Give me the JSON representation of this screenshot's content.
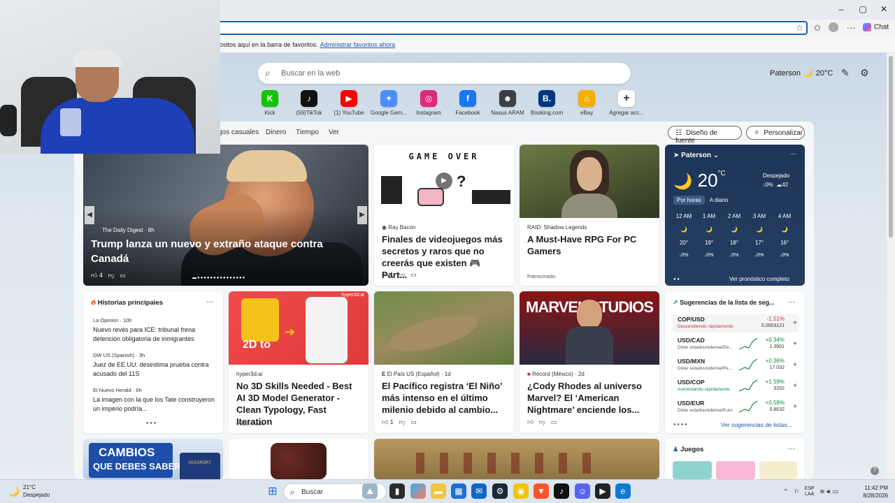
{
  "window": {
    "min": "–",
    "max": "▢",
    "close": "✕"
  },
  "toolbar": {
    "chat_label": "Chat"
  },
  "favorites_bar": {
    "text": "ositos aquí en la barra de favoritos.",
    "link": "Administrar favoritos ahora"
  },
  "search": {
    "placeholder": "Buscar en la web"
  },
  "weather_top": {
    "city": "Paterson",
    "temp": "20°C"
  },
  "quick_links": [
    {
      "label": "Kick",
      "glyph": "K",
      "color": "#12c400"
    },
    {
      "label": "(59)TikTok",
      "glyph": "♪",
      "color": "#111111"
    },
    {
      "label": "(1) YouTube",
      "glyph": "▶",
      "color": "#ff0000"
    },
    {
      "label": "Google Gem...",
      "glyph": "✦",
      "color": "#4b8df8"
    },
    {
      "label": "Instagram",
      "glyph": "◎",
      "color": "#dd2a7b"
    },
    {
      "label": "Facebook",
      "glyph": "f",
      "color": "#1877f2"
    },
    {
      "label": "Nasus ARAM",
      "glyph": "☻",
      "color": "#3b3f46"
    },
    {
      "label": "Booking.com",
      "glyph": "B.",
      "color": "#003580"
    },
    {
      "label": "eBay",
      "glyph": "⌂",
      "color": "#f5af02"
    },
    {
      "label": "Agregar acc...",
      "glyph": "+",
      "color": "#ffffff"
    }
  ],
  "nav": {
    "items": [
      "gos casuales",
      "Dinero",
      "Tiempo",
      "Ver"
    ]
  },
  "buttons": {
    "font": "Diseño de fuente",
    "personalize": "Personalizar"
  },
  "hero": {
    "source": "The Daily Digest · 8h",
    "title": "Trump lanza un nuevo y extraño ataque contra Canadá",
    "likes": "4"
  },
  "card_game": {
    "banner": "GAME OVER",
    "source": "Ray Bacon",
    "title": "Finales de videojuegos más secretos y raros que no creerás que existen 🎮 Part...",
    "likes": "1"
  },
  "card_raid": {
    "source": "RAID: Shadow Legends",
    "title": "A Must-Have RPG For PC Gamers",
    "sponsored": "Patrocinado"
  },
  "weather": {
    "city": "Paterson",
    "temp": "20",
    "unit": "°C",
    "condition": "Despejado",
    "precip": "0%",
    "humidity": "42",
    "tab_hourly": "Por horas",
    "tab_daily": "A diario",
    "hours": [
      {
        "time": "12 AM",
        "temp": "20°",
        "rain": "0%"
      },
      {
        "time": "1 AM",
        "temp": "19°",
        "rain": "0%"
      },
      {
        "time": "2 AM",
        "temp": "18°",
        "rain": "0%"
      },
      {
        "time": "3 AM",
        "temp": "17°",
        "rain": "0%"
      },
      {
        "time": "4 AM",
        "temp": "16°",
        "rain": "0%"
      }
    ],
    "more": "Ver pronóstico completo"
  },
  "stories": {
    "header": "Historias principales",
    "items": [
      {
        "source": "La Opinion · 10h",
        "title": "Nuevo revés para ICE: tribunal frena detención obligatoria de inmigrantes"
      },
      {
        "source": "DW US (Spanish) · 3h",
        "title": "Juez de EE.UU. desestima prueba contra acusado del 11S"
      },
      {
        "source": "El Nuevo Herald · 6h",
        "title": "La imagen con la que los Tate construyeron un imperio podría..."
      }
    ]
  },
  "card_3d": {
    "badge": "hyper3d.ai",
    "img_text": "2D to",
    "source": "hyper3d.ai",
    "title": "No 3D Skills Needed - Best AI 3D Model Generator - Clean Typology, Fast Iteration",
    "sponsored": "Patrocinado"
  },
  "card_nino": {
    "source": "El País US (Español) · 1d",
    "title": "El Pacífico registra ‘El Niño’ más intenso en el último milenio debido al cambio...",
    "likes": "1"
  },
  "card_cody": {
    "img_text": "MARVEL STUDIOS",
    "source": "Récord (México) · 2d",
    "title": "¿Cody Rhodes al universo Marvel? El ‘American Nightmare’ enciende los..."
  },
  "fx": {
    "header": "Sugerencias de la lista de seg...",
    "rows": [
      {
        "pair": "COP/USD",
        "desc": "Descendiendo rápidamente",
        "change": "-1.51%",
        "value": "0.0003121",
        "down": true
      },
      {
        "pair": "USD/CAD",
        "desc": "Dólar estadounidense/Dó...",
        "change": "+0.34%",
        "value": "1.3901",
        "down": false
      },
      {
        "pair": "USD/MXN",
        "desc": "Dólar estadounidense/Pe...",
        "change": "+0.36%",
        "value": "17.032",
        "down": false
      },
      {
        "pair": "USD/COP",
        "desc": "Aumentando rápidamente",
        "change": "+1.59%",
        "value": "3202",
        "down": false
      },
      {
        "pair": "USD/EUR",
        "desc": "Dólar estadounidense/Euro",
        "change": "+0.59%",
        "value": "0.8632",
        "down": false
      }
    ],
    "more": "Ver sugerencias de listas..."
  },
  "bottom": {
    "cambios_line1": "CAMBIOS",
    "cambios_line2": "QUE DEBES SABER",
    "passport": "PASSPORT",
    "games": "Juegos"
  },
  "taskbar": {
    "weather_temp": "21°C",
    "weather_cond": "Despejado",
    "search": "Buscar",
    "lang1": "ESP",
    "lang2": "LAA",
    "time": "11:42 PM",
    "date": "8/28/2026"
  },
  "colors": {
    "accent": "#1a5fb4",
    "positive": "#0f8a3c",
    "negative": "#d13438"
  }
}
